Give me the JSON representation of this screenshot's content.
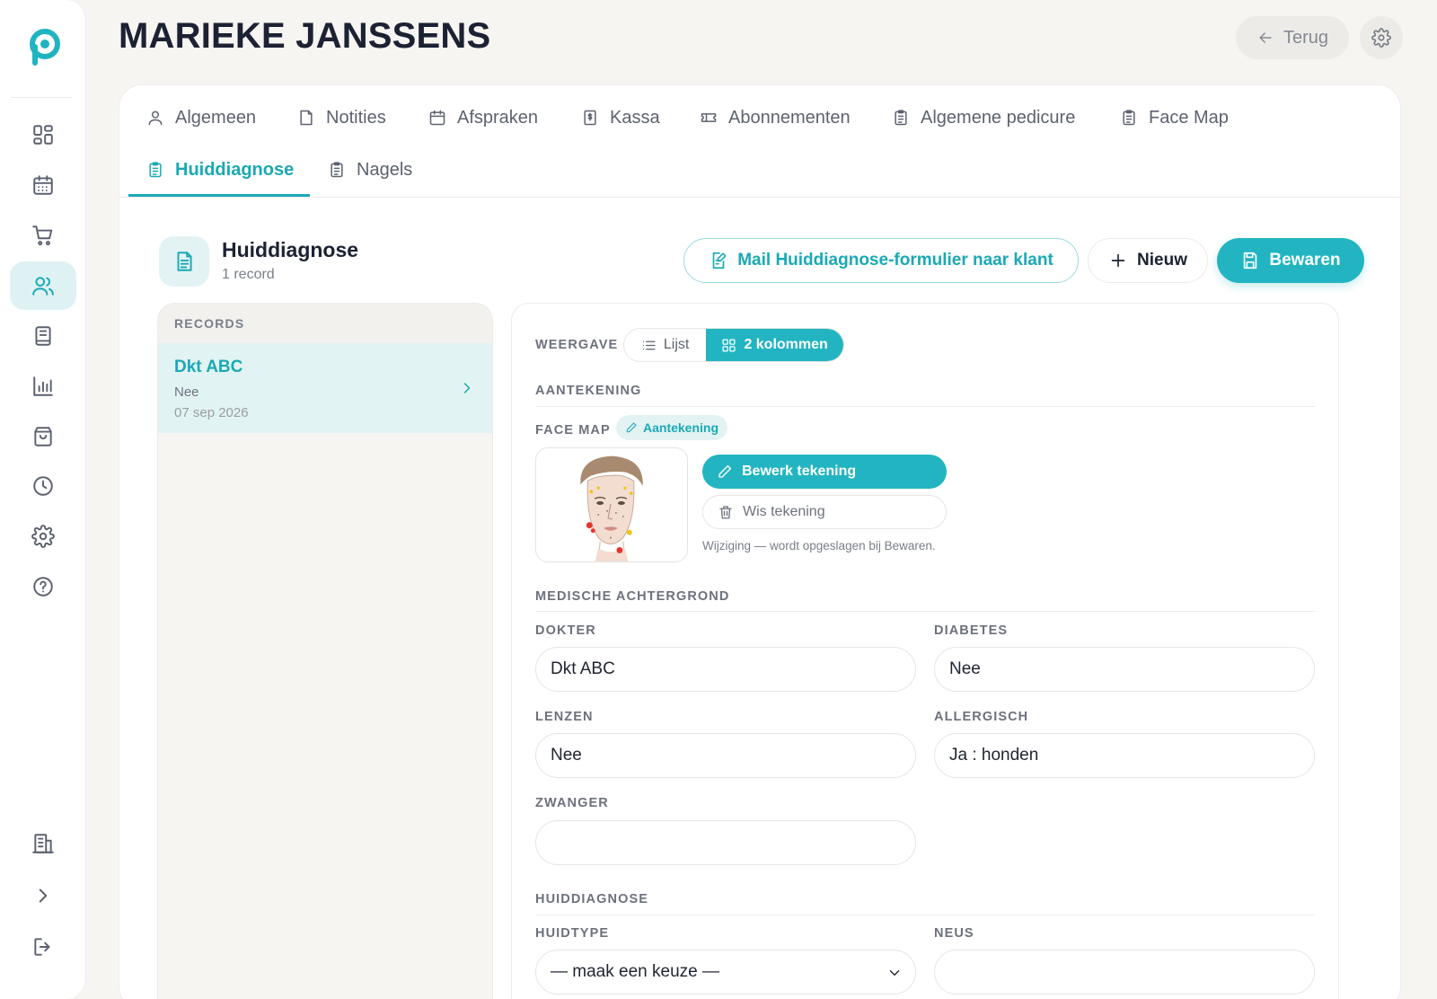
{
  "header": {
    "title": "MARIEKE JANSSENS",
    "back_label": "Terug"
  },
  "sidebar": {
    "items": [
      {
        "icon": "dashboard-icon",
        "active": false
      },
      {
        "icon": "calendar-icon",
        "active": false
      },
      {
        "icon": "cart-icon",
        "active": false
      },
      {
        "icon": "users-icon",
        "active": true
      },
      {
        "icon": "book-icon",
        "active": false
      },
      {
        "icon": "chart-icon",
        "active": false
      },
      {
        "icon": "bag-icon",
        "active": false
      },
      {
        "icon": "clock-icon",
        "active": false
      },
      {
        "icon": "gear-icon",
        "active": false
      },
      {
        "icon": "help-icon",
        "active": false
      }
    ],
    "bottom": [
      "building-icon",
      "chevron-right-icon",
      "logout-icon"
    ]
  },
  "tabs": [
    {
      "label": "Algemeen",
      "icon": "user-icon"
    },
    {
      "label": "Notities",
      "icon": "note-icon"
    },
    {
      "label": "Afspraken",
      "icon": "calendar-icon"
    },
    {
      "label": "Kassa",
      "icon": "cash-icon"
    },
    {
      "label": "Abonnementen",
      "icon": "ticket-icon"
    },
    {
      "label": "Algemene pedicure",
      "icon": "clipboard-icon"
    },
    {
      "label": "Face Map",
      "icon": "clipboard-icon"
    },
    {
      "label": "Huiddiagnose",
      "icon": "clipboard-icon",
      "active": true
    },
    {
      "label": "Nagels",
      "icon": "clipboard-icon"
    }
  ],
  "section": {
    "title": "Huiddiagnose",
    "count": "1 record",
    "mail_label": "Mail Huiddiagnose-formulier naar klant",
    "new_label": "Nieuw",
    "save_label": "Bewaren"
  },
  "records": {
    "header": "RECORDS",
    "items": [
      {
        "name": "Dkt ABC",
        "sub": "Nee",
        "date": "07 sep 2026"
      }
    ]
  },
  "form": {
    "view_label": "WEERGAVE",
    "view_list": "Lijst",
    "view_cols": "2 kolommen",
    "aantekening_section": "AANTEKENING",
    "facemap_label": "FACE MAP",
    "facemap_badge": "Aantekening",
    "edit_drawing": "Bewerk tekening",
    "clear_drawing": "Wis tekening",
    "drawing_note": "Wijziging — wordt opgeslagen bij Bewaren.",
    "medical_section": "MEDISCHE ACHTERGROND",
    "dokter_label": "DOKTER",
    "dokter_value": "Dkt ABC",
    "diabetes_label": "DIABETES",
    "diabetes_value": "Nee",
    "lenzen_label": "LENZEN",
    "lenzen_value": "Nee",
    "allergisch_label": "ALLERGISCH",
    "allergisch_value": "Ja : honden",
    "zwanger_label": "ZWANGER",
    "zwanger_value": "",
    "huid_section": "HUIDDIAGNOSE",
    "huidtype_label": "HUIDTYPE",
    "huidtype_value": "— maak een keuze —",
    "neus_label": "NEUS",
    "neus_value": ""
  },
  "colors": {
    "accent": "#22b5c1",
    "accent_light": "#e2f3f3",
    "background": "#f6f5f2"
  }
}
